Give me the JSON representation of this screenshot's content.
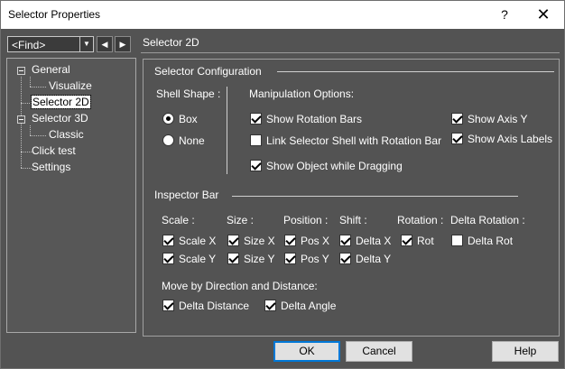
{
  "window": {
    "title": "Selector Properties",
    "help_glyph": "?",
    "close_glyph": "✕"
  },
  "find": {
    "value": "<Find>"
  },
  "tree": {
    "items": [
      {
        "label": "General"
      },
      {
        "label": "Visualize"
      },
      {
        "label": "Selector 2D"
      },
      {
        "label": "Selector 3D"
      },
      {
        "label": "Classic"
      },
      {
        "label": "Click test"
      },
      {
        "label": "Settings"
      }
    ]
  },
  "panel": {
    "title": "Selector 2D",
    "config_title": "Selector Configuration",
    "shell_shape": {
      "label": "Shell Shape :",
      "options": [
        {
          "label": "Box",
          "checked": true
        },
        {
          "label": "None",
          "checked": false
        }
      ]
    },
    "manipulation": {
      "label": "Manipulation Options:",
      "options": [
        {
          "label": "Show Rotation Bars",
          "checked": true
        },
        {
          "label": "Link Selector Shell with Rotation Bar",
          "checked": false
        },
        {
          "label": "Show Object while Dragging",
          "checked": true
        },
        {
          "label": "Show Axis Y",
          "checked": true
        },
        {
          "label": "Show Axis Labels",
          "checked": true
        }
      ]
    },
    "inspector": {
      "title": "Inspector Bar",
      "columns": [
        {
          "header": "Scale :",
          "items": [
            {
              "label": "Scale X",
              "checked": true
            },
            {
              "label": "Scale Y",
              "checked": true
            }
          ]
        },
        {
          "header": "Size :",
          "items": [
            {
              "label": "Size X",
              "checked": true
            },
            {
              "label": "Size Y",
              "checked": true
            }
          ]
        },
        {
          "header": "Position :",
          "items": [
            {
              "label": "Pos X",
              "checked": true
            },
            {
              "label": "Pos Y",
              "checked": true
            }
          ]
        },
        {
          "header": "Shift :",
          "items": [
            {
              "label": "Delta X",
              "checked": true
            },
            {
              "label": "Delta Y",
              "checked": true
            }
          ]
        },
        {
          "header": "Rotation :",
          "items": [
            {
              "label": "Rot",
              "checked": true
            }
          ]
        },
        {
          "header": "Delta Rotation :",
          "items": [
            {
              "label": "Delta Rot",
              "checked": false
            }
          ]
        }
      ]
    },
    "move": {
      "label": "Move by Direction and Distance:",
      "options": [
        {
          "label": "Delta Distance",
          "checked": true
        },
        {
          "label": "Delta Angle",
          "checked": true
        }
      ]
    }
  },
  "buttons": {
    "ok": "OK",
    "cancel": "Cancel",
    "help": "Help"
  }
}
